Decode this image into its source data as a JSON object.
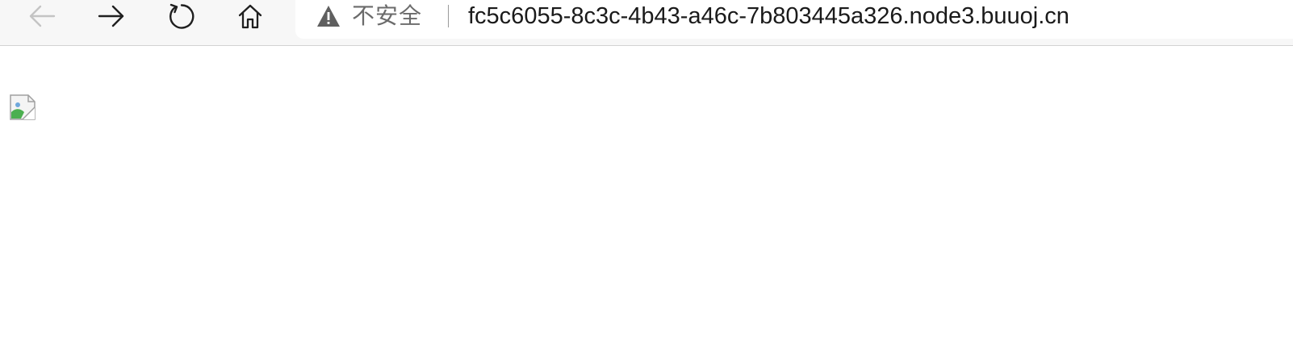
{
  "browser": {
    "toolbar": {
      "back_icon": "arrow-left-icon",
      "forward_icon": "arrow-right-icon",
      "reload_icon": "refresh-icon",
      "home_icon": "home-icon"
    },
    "address_bar": {
      "security_icon": "warning-triangle-icon",
      "security_label": "不安全",
      "url": "fc5c6055-8c3c-4b43-a46c-7b803445a326.node3.buuoj.cn"
    }
  },
  "page": {
    "image": {
      "state": "broken",
      "icon": "broken-image-icon"
    }
  },
  "colors": {
    "toolbar_bg": "#f7f7f7",
    "disabled_icon": "#c4c4c4",
    "icon": "#1f1f1f",
    "security_text": "#6b6b6b",
    "url_text": "#1a1a1a"
  }
}
